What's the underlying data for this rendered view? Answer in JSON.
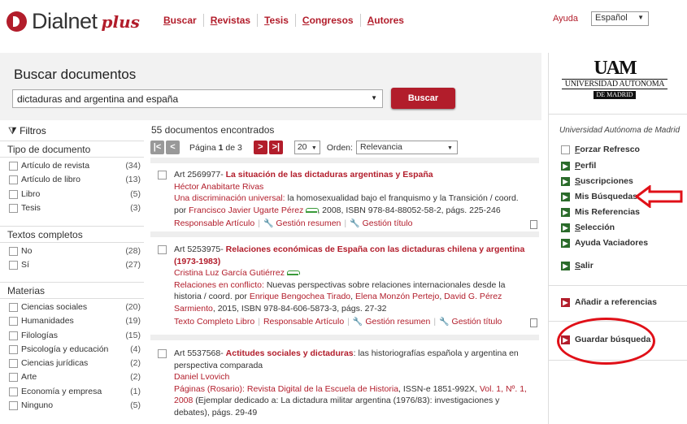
{
  "header": {
    "logo_text": "Dialnet",
    "logo_plus": "plus",
    "nav": [
      "Buscar",
      "Revistas",
      "Tesis",
      "Congresos",
      "Autores"
    ],
    "help": "Ayuda",
    "language": "Español"
  },
  "search": {
    "title": "Buscar documentos",
    "query": "dictaduras and argentina and españa",
    "button": "Buscar"
  },
  "filters": {
    "title": "Filtros",
    "sections": [
      {
        "title": "Tipo de documento",
        "items": [
          {
            "label": "Artículo de revista",
            "count": "(34)"
          },
          {
            "label": "Artículo de libro",
            "count": "(13)"
          },
          {
            "label": "Libro",
            "count": "(5)"
          },
          {
            "label": "Tesis",
            "count": "(3)"
          }
        ]
      },
      {
        "title": "Textos completos",
        "items": [
          {
            "label": "No",
            "count": "(28)"
          },
          {
            "label": "Sí",
            "count": "(27)"
          }
        ]
      },
      {
        "title": "Materias",
        "items": [
          {
            "label": "Ciencias sociales",
            "count": "(20)"
          },
          {
            "label": "Humanidades",
            "count": "(19)"
          },
          {
            "label": "Filologías",
            "count": "(15)"
          },
          {
            "label": "Psicología y educación",
            "count": "(4)"
          },
          {
            "label": "Ciencias jurídicas",
            "count": "(2)"
          },
          {
            "label": "Arte",
            "count": "(2)"
          },
          {
            "label": "Economía y empresa",
            "count": "(1)"
          },
          {
            "label": "Ninguno",
            "count": "(5)"
          }
        ]
      }
    ]
  },
  "results": {
    "count": "55 documentos encontrados",
    "page_prefix": "Página",
    "page_current": "1",
    "page_suffix": "de 3",
    "per_page": "20",
    "order_label": "Orden:",
    "order_value": "Relevancia",
    "items": [
      {
        "id": "Art 2569977-",
        "title": "La situación de las dictaduras argentinas y España",
        "author": "Héctor Anabitarte Rivas",
        "pub1": "Una discriminación universal:",
        "pub2": "la homosexualidad bajo el franquismo y la Transición / coord.",
        "pub3a": "por",
        "pub3b": "Francisco Javier Ugarte Pérez",
        "pub3c": ", 2008, ISBN 978-84-88052-58-2, págs. 225-246",
        "links": [
          "Responsable Artículo",
          "Gestión resumen",
          "Gestión título"
        ]
      },
      {
        "id": "Art 5253975-",
        "title": "Relaciones económicas de España con las dictaduras chilena y argentina (1973-1983)",
        "author": "Cristina Luz García Gutiérrez",
        "pub1": "Relaciones en conflicto:",
        "pub2": "Nuevas perspectivas sobre relaciones internacionales desde la historia / coord. por",
        "pub3a": "Enrique Bengochea Tirado",
        "pub3b": "Elena Monzón Pertejo",
        "pub3c": "David G. Pérez Sarmiento",
        "pub3d": ", 2015, ISBN 978-84-606-5873-3, págs. 27-32",
        "links": [
          "Texto Completo Libro",
          "Responsable Artículo",
          "Gestión resumen",
          "Gestión título"
        ]
      },
      {
        "id": "Art 5537568-",
        "title": "Actitudes sociales y dictaduras",
        "title_rest": ": las historiografías española y argentina en perspectiva comparada",
        "author": "Daniel Lvovich",
        "pub1": "Páginas (Rosario): Revista Digital de la Escuela de Historia",
        "pub2": ", ISSN-e 1851-992X,",
        "pub3a": "Vol. 1, Nº. 1, 2008",
        "pub3b": "(Ejemplar dedicado a: La dictadura militar argentina (1976/83): investigaciones y debates), págs. 29-49"
      }
    ]
  },
  "sidebar_right": {
    "uni_logo_big": "UAM",
    "uni_logo_line1": "UNIVERSIDAD AUTONOMA",
    "uni_logo_line2": "DE MADRID",
    "uni_name": "Universidad Autónoma de Madrid",
    "refresh": "Forzar Refresco",
    "links": [
      "Perfil",
      "Suscripciones",
      "Mis Búsquedas",
      "Mis Referencias",
      "Selección",
      "Ayuda Vaciadores"
    ],
    "logout": "Salir",
    "add_refs": "Añadir a referencias",
    "save_search": "Guardar búsqueda"
  },
  "colors": {
    "brand": "#b21d2b",
    "green": "#2a6b2a",
    "annotation": "#e01018"
  }
}
